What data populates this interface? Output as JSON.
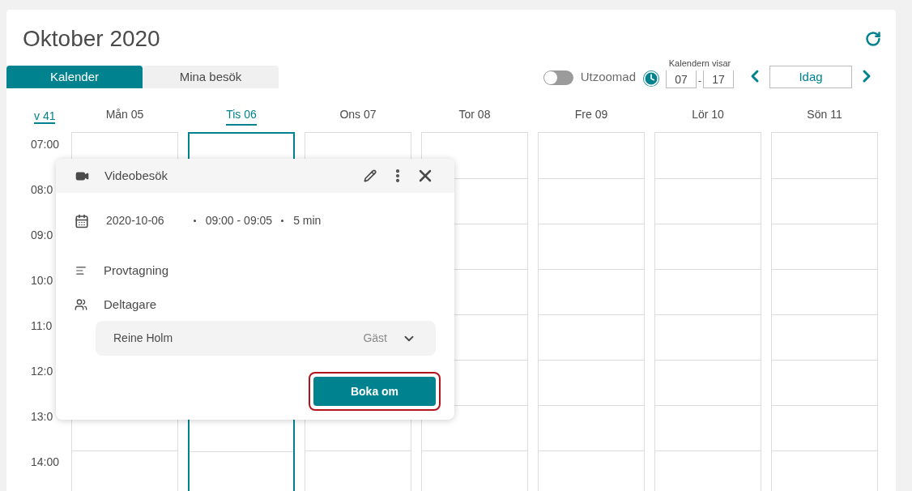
{
  "title": "Oktober 2020",
  "tabs": [
    {
      "label": "Kalender",
      "selected": true
    },
    {
      "label": "Mina besök",
      "selected": false
    }
  ],
  "zoom_toggle": {
    "label": "Utzoomad",
    "on": false
  },
  "hours_range": {
    "label": "Kalendern visar",
    "from": "07",
    "separator": "-",
    "to": "17"
  },
  "today_button": "Idag",
  "week": "v 41",
  "days": [
    {
      "label": "Mån 05",
      "selected": false
    },
    {
      "label": "Tis 06",
      "selected": true
    },
    {
      "label": "Ons 07",
      "selected": false
    },
    {
      "label": "Tor 08",
      "selected": false
    },
    {
      "label": "Fre 09",
      "selected": false
    },
    {
      "label": "Lör 10",
      "selected": false
    },
    {
      "label": "Sön 11",
      "selected": false
    }
  ],
  "hours": [
    "07:00",
    "08:0",
    "09:0",
    "10:0",
    "11:0",
    "12:0",
    "13:0",
    "14:00"
  ],
  "popup": {
    "type": "Videobesök",
    "date": "2020-10-06",
    "time": "09:00 - 09:05",
    "duration": "5 min",
    "description": "Provtagning",
    "participants_label": "Deltagare",
    "participants": [
      {
        "name": "Reine Holm",
        "role": "Gäst"
      }
    ],
    "action": {
      "label": "Boka om",
      "focused": true
    }
  }
}
